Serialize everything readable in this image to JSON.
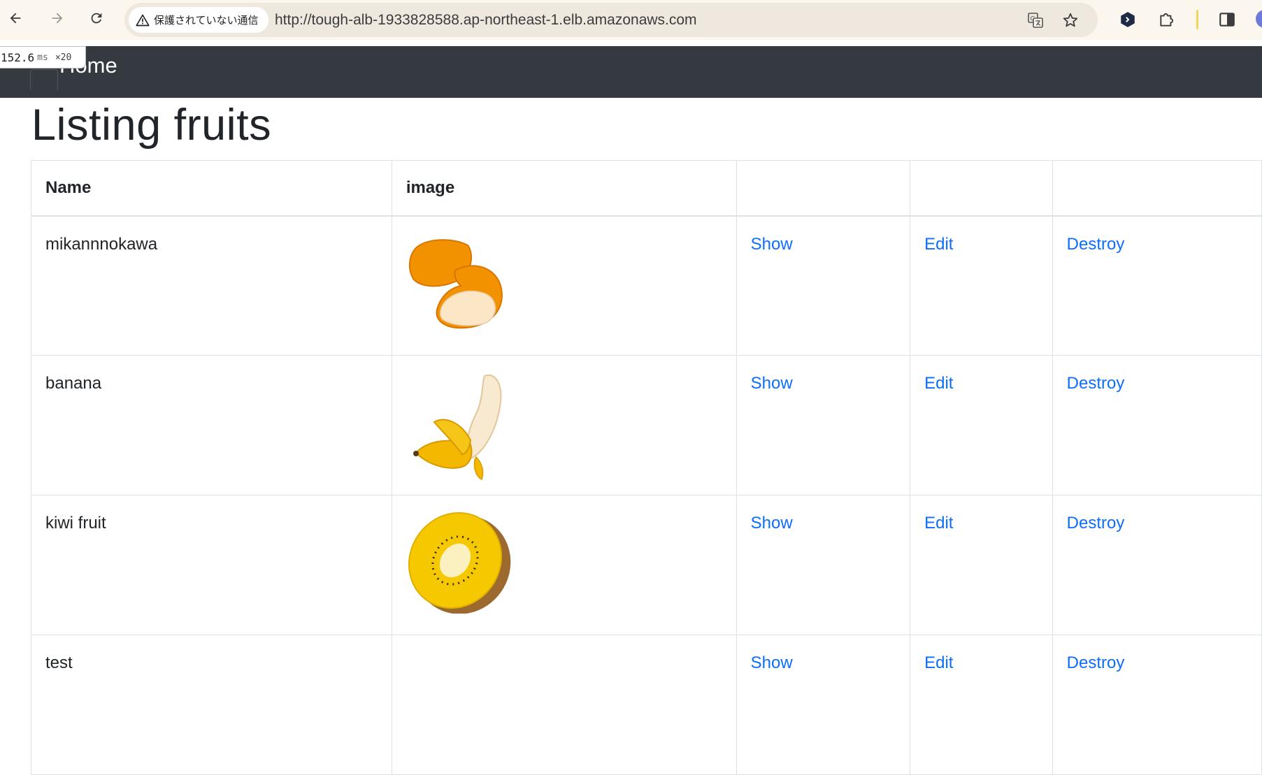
{
  "browser": {
    "url": "http://tough-alb-1933828588.ap-northeast-1.elb.amazonaws.com",
    "security_label": "保護されていない通信"
  },
  "perf_overlay": {
    "value": "152.6",
    "unit": "ms",
    "multiplier": "×20"
  },
  "navbar": {
    "brand": "Home"
  },
  "page": {
    "title": "Listing fruits"
  },
  "table": {
    "headers": [
      "Name",
      "image",
      "",
      "",
      ""
    ],
    "rows": [
      {
        "name": "mikannnokawa",
        "image_icon": "orange-peel-icon",
        "show": "Show",
        "edit": "Edit",
        "destroy": "Destroy"
      },
      {
        "name": "banana",
        "image_icon": "banana-icon",
        "show": "Show",
        "edit": "Edit",
        "destroy": "Destroy"
      },
      {
        "name": "kiwi fruit",
        "image_icon": "golden-kiwi-icon",
        "show": "Show",
        "edit": "Edit",
        "destroy": "Destroy"
      },
      {
        "name": "test",
        "image_icon": "",
        "show": "Show",
        "edit": "Edit",
        "destroy": "Destroy"
      }
    ]
  },
  "colors": {
    "navbar_bg": "#343a40",
    "link": "#0d6efd",
    "chrome_bg": "#fbf6ee"
  }
}
